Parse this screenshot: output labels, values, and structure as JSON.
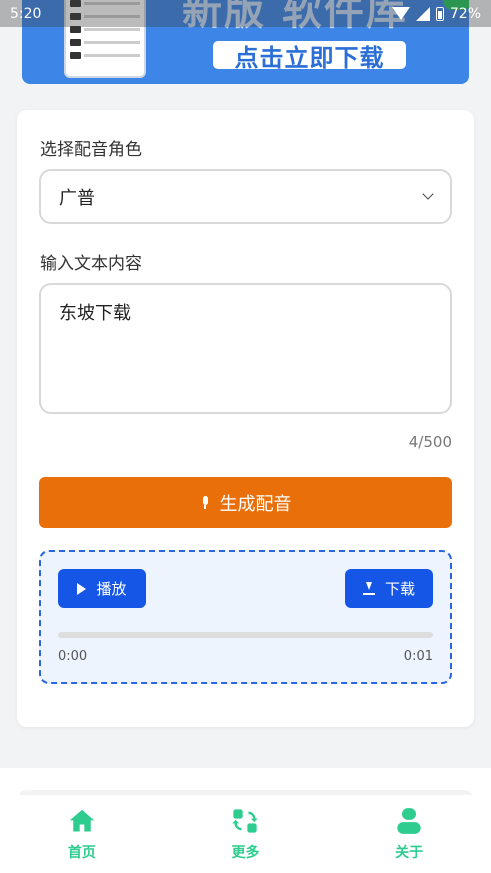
{
  "status_bar": {
    "time": "5:20",
    "battery": "72%"
  },
  "banner": {
    "title": "新版 软件库",
    "button": "点击立即下载"
  },
  "form": {
    "role_label": "选择配音角色",
    "role_value": "广普",
    "text_label": "输入文本内容",
    "text_value": "东坡下载",
    "counter": "4/500",
    "generate_button": "生成配音"
  },
  "player": {
    "play_button": "播放",
    "download_button": "下载",
    "current_time": "0:00",
    "duration": "0:01",
    "progress": 0
  },
  "tabbar": {
    "items": [
      {
        "label": "首页",
        "icon": "home-icon"
      },
      {
        "label": "更多",
        "icon": "more-icon"
      },
      {
        "label": "关于",
        "icon": "about-icon"
      }
    ]
  },
  "colors": {
    "accent": "#e86f0a",
    "primary": "#1656e6",
    "tab": "#2ecc8f"
  }
}
